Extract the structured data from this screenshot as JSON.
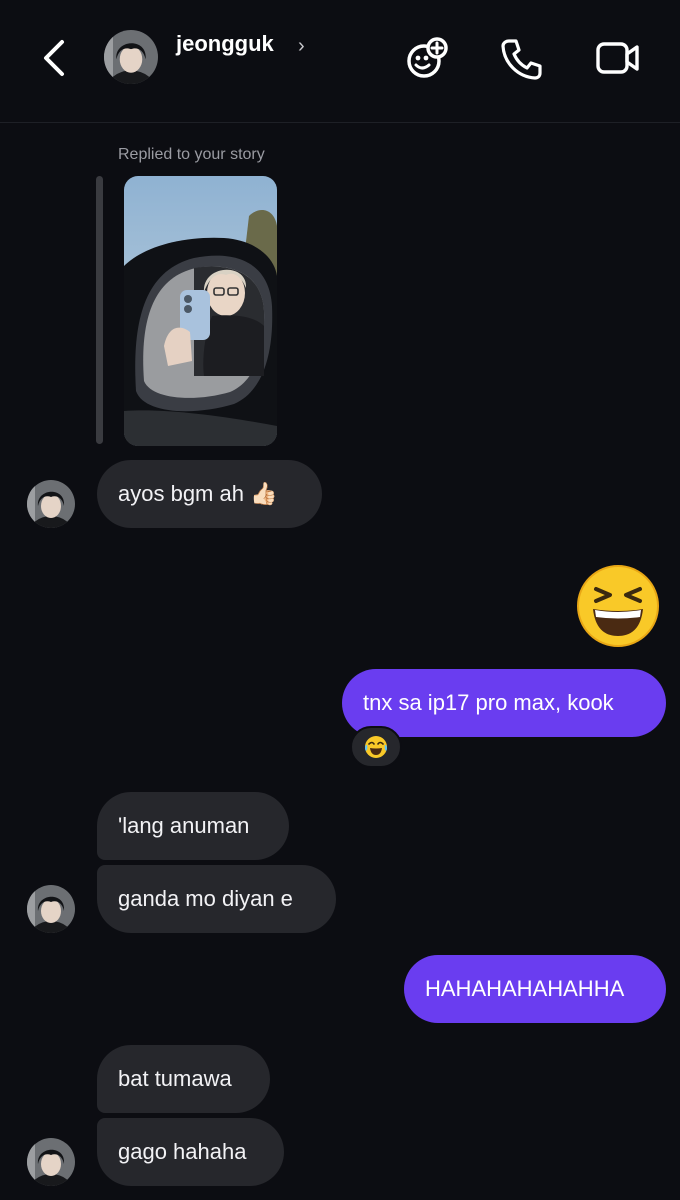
{
  "header": {
    "username": "jeongguk",
    "chevron": "›",
    "icons": [
      "back-arrow-icon",
      "game-controller-add-icon",
      "phone-icon",
      "video-camera-icon"
    ]
  },
  "story_reply": {
    "label": "Replied to your story"
  },
  "messages": [
    {
      "from": "them",
      "text": "ayos bgm ah 👍🏻"
    },
    {
      "from": "me",
      "text": "😆"
    },
    {
      "from": "me",
      "text": "tnx sa ip17 pro max, kook",
      "reaction": "😂"
    },
    {
      "from": "them",
      "text": "'lang anuman"
    },
    {
      "from": "them",
      "text": "ganda mo diyan e"
    },
    {
      "from": "me",
      "text": "HAHAHAHAHAHHA"
    },
    {
      "from": "them",
      "text": "bat tumawa"
    },
    {
      "from": "them",
      "text": "gago hahaha"
    }
  ],
  "colors": {
    "background": "#0c0d12",
    "incoming_bubble": "#26272c",
    "outgoing_bubble": "#6a3df0"
  }
}
